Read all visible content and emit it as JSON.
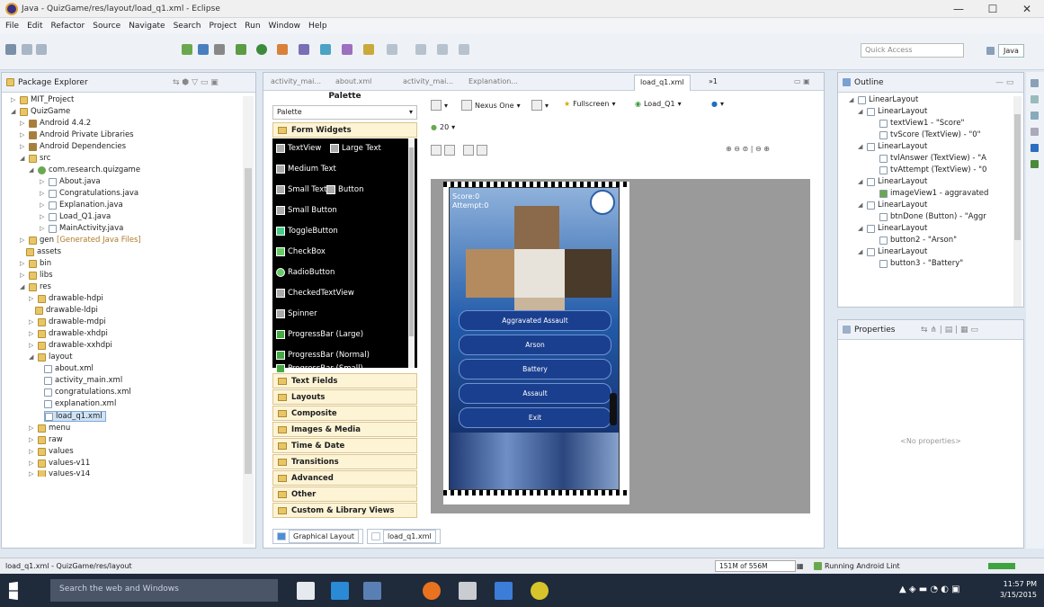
{
  "window": {
    "title": "Java - QuizGame/res/layout/load_q1.xml - Eclipse",
    "controls": [
      "—",
      "☐",
      "✕"
    ]
  },
  "menu": [
    "File",
    "Edit",
    "Refactor",
    "Source",
    "Navigate",
    "Search",
    "Project",
    "Run",
    "Window",
    "Help"
  ],
  "toolbar": {
    "quick_access_placeholder": "Quick Access",
    "perspective": "Java"
  },
  "package_explorer": {
    "tab_label": "Package Explorer",
    "items": [
      {
        "label": "MIT_Project",
        "type": "project"
      },
      {
        "label": "QuizGame",
        "type": "project"
      },
      {
        "label": "Android 4.4.2",
        "type": "lib"
      },
      {
        "label": "Android Private Libraries",
        "type": "lib"
      },
      {
        "label": "Android Dependencies",
        "type": "lib"
      },
      {
        "label": "src",
        "type": "folder"
      },
      {
        "label": "com.research.quizgame",
        "type": "package"
      },
      {
        "label": "About.java",
        "type": "file"
      },
      {
        "label": "Congratulations.java",
        "type": "file"
      },
      {
        "label": "Explanation.java",
        "type": "file"
      },
      {
        "label": "Load_Q1.java",
        "type": "file"
      },
      {
        "label": "MainActivity.java",
        "type": "file"
      },
      {
        "label": "gen",
        "suffix": "[Generated Java Files]",
        "type": "folder"
      },
      {
        "label": "assets",
        "type": "folder"
      },
      {
        "label": "bin",
        "type": "folder"
      },
      {
        "label": "libs",
        "type": "folder"
      },
      {
        "label": "res",
        "type": "folder"
      },
      {
        "label": "drawable-hdpi",
        "type": "folder"
      },
      {
        "label": "drawable-ldpi",
        "type": "folder"
      },
      {
        "label": "drawable-mdpi",
        "type": "folder"
      },
      {
        "label": "drawable-xhdpi",
        "type": "folder"
      },
      {
        "label": "drawable-xxhdpi",
        "type": "folder"
      },
      {
        "label": "layout",
        "type": "folder"
      },
      {
        "label": "about.xml",
        "type": "file"
      },
      {
        "label": "activity_main.xml",
        "type": "file"
      },
      {
        "label": "congratulations.xml",
        "type": "file"
      },
      {
        "label": "explanation.xml",
        "type": "file"
      },
      {
        "label": "load_q1.xml",
        "type": "file",
        "selected": true
      },
      {
        "label": "menu",
        "type": "folder"
      },
      {
        "label": "raw",
        "type": "folder"
      },
      {
        "label": "values",
        "type": "folder"
      },
      {
        "label": "values-v11",
        "type": "folder"
      },
      {
        "label": "values-v14",
        "type": "folder"
      }
    ]
  },
  "editor": {
    "tabs": [
      "activity_mai...",
      "about.xml",
      "activity_mai...",
      "Explanation...",
      "load_q1.xml",
      "»1"
    ],
    "palette_title": "Palette",
    "palette_dropdown": "Palette",
    "categories": [
      "Form Widgets",
      "Text Fields",
      "Layouts",
      "Composite",
      "Images & Media",
      "Time & Date",
      "Transitions",
      "Advanced",
      "Other",
      "Custom & Library Views"
    ],
    "widgets": [
      "TextView",
      "Large Text",
      "Medium Text",
      "Small Text",
      "Button",
      "Small Button",
      "ToggleButton",
      "CheckBox",
      "RadioButton",
      "CheckedTextView",
      "Spinner",
      "ProgressBar (Large)",
      "ProgressBar (Normal)",
      "ProgressBar (Small)"
    ],
    "device": "Nexus One",
    "theme": "Fullscreen",
    "activity": "Load_Q1",
    "api": "20",
    "bottom_tabs": [
      "Graphical Layout",
      "load_q1.xml"
    ]
  },
  "preview": {
    "score_text": "Score:0",
    "attempt_text": "Attempt:0",
    "buttons": [
      "Aggravated Assault",
      "Arson",
      "Battery",
      "Assault",
      "Exit"
    ]
  },
  "outline": {
    "tab_label": "Outline",
    "items": [
      {
        "label": "LinearLayout",
        "indent": 0
      },
      {
        "label": "LinearLayout",
        "indent": 1
      },
      {
        "label": "textView1 - \"Score\"",
        "indent": 2
      },
      {
        "label": "tvScore (TextView) - \"0\"",
        "indent": 2
      },
      {
        "label": "LinearLayout",
        "indent": 1
      },
      {
        "label": "tvlAnswer (TextView) - \"A",
        "indent": 2
      },
      {
        "label": "tvAttempt (TextView) - \"0",
        "indent": 2
      },
      {
        "label": "LinearLayout",
        "indent": 1
      },
      {
        "label": "imageView1 - aggravated",
        "indent": 2
      },
      {
        "label": "LinearLayout",
        "indent": 1
      },
      {
        "label": "btnDone (Button) - \"Aggr",
        "indent": 2
      },
      {
        "label": "LinearLayout",
        "indent": 1
      },
      {
        "label": "button2 - \"Arson\"",
        "indent": 2
      },
      {
        "label": "LinearLayout",
        "indent": 1
      },
      {
        "label": "button3 - \"Battery\"",
        "indent": 2
      }
    ]
  },
  "properties": {
    "tab_label": "Properties",
    "empty_text": "<No properties>"
  },
  "statusbar": {
    "path": "load_q1.xml - QuizGame/res/layout",
    "memory": "151M of 556M",
    "task": "Running Android Lint"
  },
  "taskbar": {
    "search_placeholder": "Search the web and Windows",
    "time": "11:57 PM",
    "date": "3/15/2015"
  },
  "colors": {
    "accent": "#1f6fc2",
    "taskbar": "#1f2a3b",
    "palette_black": "#000000"
  }
}
